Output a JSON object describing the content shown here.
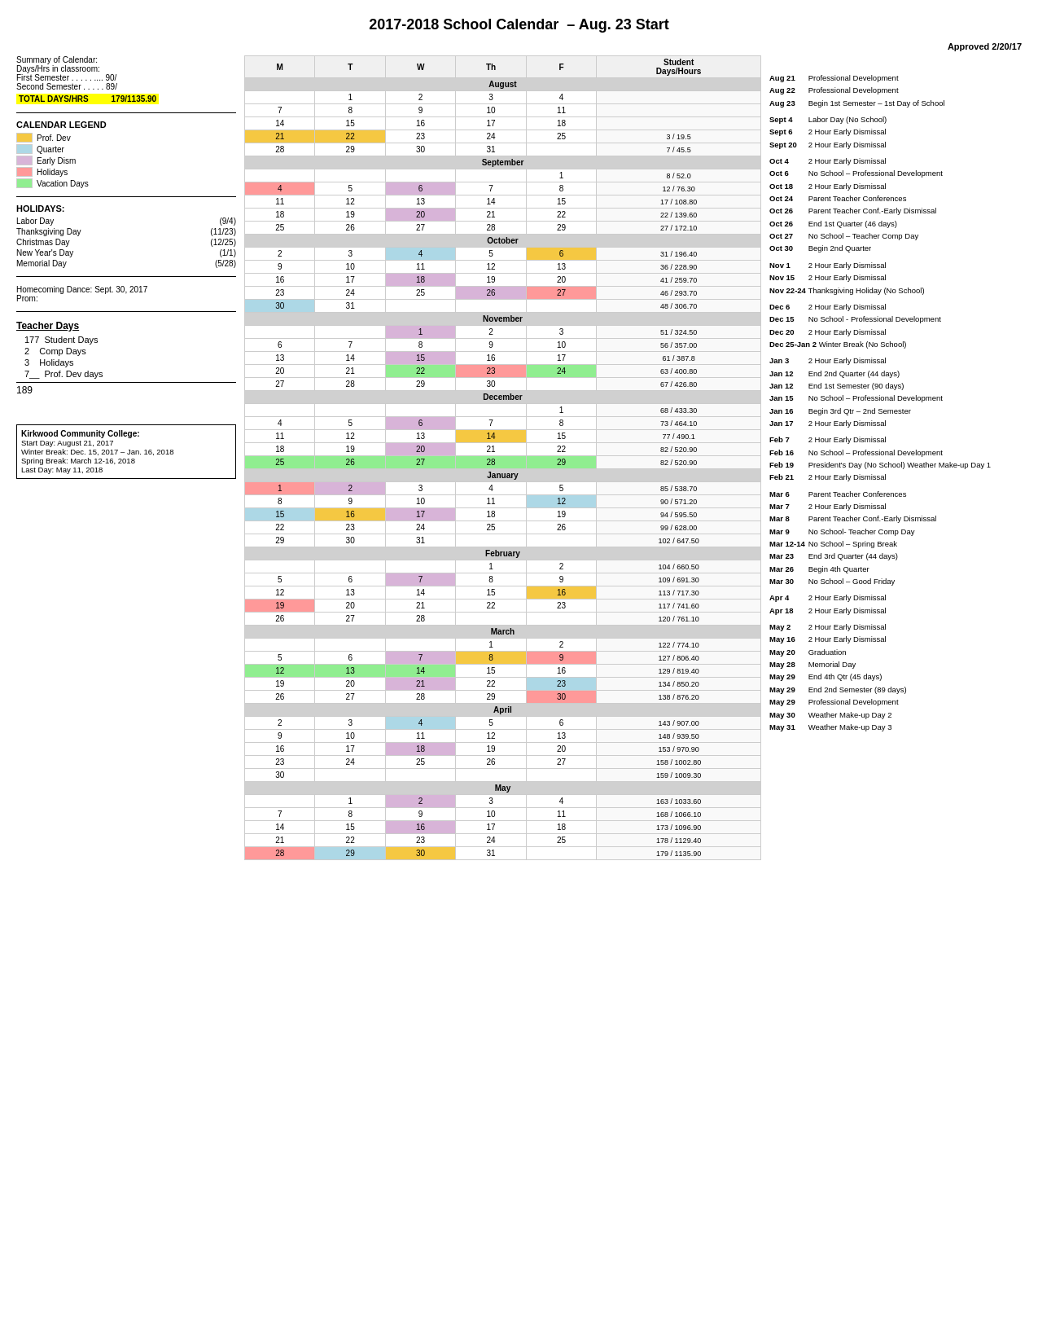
{
  "title": "2017-2018 School Calendar",
  "subtitle": "Aug. 23 Start",
  "approved": "Approved 2/20/17",
  "summary": {
    "label1": "Summary of Calendar:",
    "label2": "Days/Hrs in classroom:",
    "first_semester": "First Semester . . . . . .... 90/",
    "second_semester": "Second Semester . . . . . 89/",
    "total_label": "TOTAL DAYS/HRS",
    "total_value": "179/",
    "total_sub": "1135.90"
  },
  "legend": {
    "title": "CALENDAR LEGEND",
    "items": [
      {
        "label": "Prof. Dev",
        "color": "#f5c842"
      },
      {
        "label": "Quarter",
        "color": "#add8e6"
      },
      {
        "label": "Early Dism",
        "color": "#d8b4d8"
      },
      {
        "label": "Holidays",
        "color": "#ff9999"
      },
      {
        "label": "Vacation Days",
        "color": "#90ee90"
      }
    ]
  },
  "holidays": {
    "title": "HOLIDAYS:",
    "items": [
      {
        "name": "Labor Day",
        "date": "(9/4)"
      },
      {
        "name": "Thanksgiving Day",
        "date": "(11/23)"
      },
      {
        "name": "Christmas Day",
        "date": "(12/25)"
      },
      {
        "name": "New Year's Day",
        "date": "(1/1)"
      },
      {
        "name": "Memorial Day",
        "date": "(5/28)"
      }
    ]
  },
  "events": [
    "Homecoming Dance: Sept. 30, 2017",
    "Prom:"
  ],
  "teacher_days": {
    "title": "Teacher Days",
    "items": [
      {
        "number": "177",
        "label": "Student Days"
      },
      {
        "number": "2",
        "label": "Comp Days"
      },
      {
        "number": "3",
        "label": "Holidays"
      },
      {
        "number": "7__",
        "label": "Prof. Dev days"
      }
    ],
    "total": "189"
  },
  "kcc": {
    "title": "Kirkwood Community College:",
    "items": [
      "Start Day:  August 21, 2017",
      "Winter Break: Dec. 15, 2017 – Jan. 16, 2018",
      "Spring Break: March 12-16, 2018",
      "Last Day: May 11, 2018"
    ]
  },
  "col_headers": [
    "M",
    "T",
    "W",
    "Th",
    "F",
    "Student Days/Hours"
  ],
  "months": [
    {
      "name": "August",
      "weeks": [
        [
          null,
          1,
          2,
          3,
          4,
          null
        ],
        [
          7,
          8,
          9,
          10,
          11,
          null
        ],
        [
          14,
          15,
          16,
          17,
          18,
          null
        ],
        [
          "21Y",
          "22Y",
          "23O",
          24,
          "25",
          "3 / 19.5"
        ],
        [
          28,
          29,
          30,
          31,
          null,
          "7 / 45.5"
        ]
      ]
    },
    {
      "name": "September",
      "weeks": [
        [
          null,
          null,
          null,
          null,
          "1",
          "8 / 52.0"
        ],
        [
          "4H",
          5,
          "6E",
          7,
          "8",
          "12 / 76.30"
        ],
        [
          11,
          12,
          13,
          14,
          "15",
          "17 / 108.80"
        ],
        [
          18,
          19,
          "20E",
          21,
          "22",
          "22 / 139.60"
        ],
        [
          25,
          26,
          27,
          28,
          "29",
          "27 / 172.10"
        ]
      ]
    },
    {
      "name": "October",
      "weeks": [
        [
          2,
          3,
          "4Q",
          5,
          "6Y",
          "31 / 196.40"
        ],
        [
          9,
          10,
          11,
          12,
          "13",
          "36 / 228.90"
        ],
        [
          16,
          17,
          "18E",
          19,
          "20",
          "41 / 259.70"
        ],
        [
          23,
          24,
          25,
          "26E",
          "27H",
          "46 / 293.70"
        ],
        [
          "30Q",
          31,
          null,
          null,
          null,
          "48 / 306.70"
        ]
      ]
    },
    {
      "name": "November",
      "weeks": [
        [
          null,
          null,
          "1E",
          2,
          "3",
          "51 / 324.50"
        ],
        [
          6,
          7,
          8,
          9,
          "10",
          "56 / 357.00"
        ],
        [
          13,
          14,
          "15E",
          16,
          "17",
          "61 / 387.8"
        ],
        [
          20,
          21,
          "22V",
          "23H",
          "24V",
          "63 / 400.80"
        ],
        [
          27,
          28,
          29,
          30,
          null,
          "67 / 426.80"
        ]
      ]
    },
    {
      "name": "December",
      "weeks": [
        [
          null,
          null,
          null,
          null,
          "1",
          "68 / 433.30"
        ],
        [
          4,
          5,
          "6E",
          7,
          "8",
          "73 / 464.10"
        ],
        [
          11,
          12,
          13,
          "14Y",
          "15",
          "77 / 490.1"
        ],
        [
          18,
          19,
          "20E",
          21,
          "22",
          "82 / 520.90"
        ],
        [
          "25V",
          "26V",
          "27V",
          "28V",
          "29V",
          "82 / 520.90"
        ]
      ]
    },
    {
      "name": "January",
      "weeks": [
        [
          "1H",
          "2E",
          3,
          4,
          "5",
          "85 / 538.70"
        ],
        [
          8,
          9,
          10,
          "11",
          "12Q",
          "90 / 571.20"
        ],
        [
          "15Q",
          "16Y",
          "17E",
          18,
          "19",
          "94 / 595.50"
        ],
        [
          22,
          23,
          24,
          25,
          "26",
          "99 / 628.00"
        ],
        [
          29,
          30,
          31,
          null,
          null,
          "102 / 647.50"
        ]
      ]
    },
    {
      "name": "February",
      "weeks": [
        [
          null,
          null,
          null,
          1,
          "2",
          "104 / 660.50"
        ],
        [
          5,
          6,
          "7E",
          8,
          "9",
          "109 / 691.30"
        ],
        [
          12,
          13,
          14,
          15,
          "16Y",
          "113 / 717.30"
        ],
        [
          "19H",
          20,
          21,
          22,
          "23",
          "117 / 741.60"
        ],
        [
          26,
          27,
          28,
          null,
          null,
          "120 / 761.10"
        ]
      ]
    },
    {
      "name": "March",
      "weeks": [
        [
          null,
          null,
          null,
          1,
          "2",
          "122 / 774.10"
        ],
        [
          5,
          6,
          "7E",
          "8Y",
          "9H",
          "127 / 806.40"
        ],
        [
          "12V",
          "13V",
          "14V",
          15,
          "16",
          "129 / 819.40"
        ],
        [
          19,
          20,
          "21E",
          22,
          "23Q",
          "134 / 850.20"
        ],
        [
          26,
          27,
          28,
          29,
          "30H",
          "138 / 876.20"
        ]
      ]
    },
    {
      "name": "April",
      "weeks": [
        [
          2,
          3,
          "4Q",
          5,
          "6",
          "143 / 907.00"
        ],
        [
          9,
          10,
          11,
          12,
          "13",
          "148 / 939.50"
        ],
        [
          16,
          17,
          "18E",
          19,
          "20",
          "153 / 970.90"
        ],
        [
          23,
          24,
          25,
          26,
          "27",
          "158 / 1002.80"
        ],
        [
          30,
          null,
          null,
          null,
          null,
          "159 / 1009.30"
        ]
      ]
    },
    {
      "name": "May",
      "weeks": [
        [
          null,
          1,
          "2E",
          3,
          "4",
          "163 / 1033.60"
        ],
        [
          7,
          8,
          9,
          10,
          "11",
          "168 / 1066.10"
        ],
        [
          14,
          15,
          "16E",
          17,
          "18",
          "173 / 1096.90"
        ],
        [
          21,
          22,
          23,
          24,
          "25",
          "178 / 1129.40"
        ],
        [
          "28H",
          "29Q",
          "30Y",
          31,
          null,
          "179 / 1135.90"
        ]
      ]
    }
  ],
  "right_events": [
    {
      "date": "Aug 21",
      "text": "Professional Development"
    },
    {
      "date": "Aug 22",
      "text": "Professional Development"
    },
    {
      "date": "Aug 23",
      "text": "Begin 1st Semester – 1st Day of School"
    },
    {
      "spacer": true
    },
    {
      "date": "Sept 4",
      "text": "Labor Day (No School)"
    },
    {
      "date": "Sept 6",
      "text": "2 Hour Early Dismissal"
    },
    {
      "date": "Sept 20",
      "text": "2 Hour Early Dismissal"
    },
    {
      "spacer": true
    },
    {
      "date": "Oct 4",
      "text": "2 Hour Early Dismissal"
    },
    {
      "date": "Oct 6",
      "text": "No School – Professional Development"
    },
    {
      "date": "Oct 18",
      "text": "2 Hour Early Dismissal"
    },
    {
      "date": "Oct 24",
      "text": "Parent Teacher Conferences"
    },
    {
      "date": "Oct 26",
      "text": "Parent Teacher Conf.-Early Dismissal"
    },
    {
      "date": "Oct 26",
      "text": "End 1st Quarter (46 days)"
    },
    {
      "date": "Oct 27",
      "text": "No School – Teacher Comp Day"
    },
    {
      "date": "Oct 30",
      "text": "Begin 2nd Quarter"
    },
    {
      "spacer": true
    },
    {
      "date": "Nov 1",
      "text": "2 Hour Early Dismissal"
    },
    {
      "date": "Nov 15",
      "text": "2 Hour Early Dismissal"
    },
    {
      "date": "Nov 22-24",
      "text": "Thanksgiving Holiday (No School)"
    },
    {
      "spacer": true
    },
    {
      "date": "Dec 6",
      "text": "2 Hour Early Dismissal"
    },
    {
      "date": "Dec 15",
      "text": "No School - Professional Development"
    },
    {
      "date": "Dec 20",
      "text": "2 Hour Early Dismissal"
    },
    {
      "date": "Dec 25-Jan 2",
      "text": "Winter Break (No School)"
    },
    {
      "spacer": true
    },
    {
      "date": "Jan 3",
      "text": "2 Hour Early Dismissal"
    },
    {
      "date": "Jan 12",
      "text": "End 2nd Quarter (44 days)"
    },
    {
      "date": "Jan 12",
      "text": "End 1st Semester (90 days)"
    },
    {
      "date": "Jan 15",
      "text": "No School – Professional Development"
    },
    {
      "date": "Jan 16",
      "text": "Begin 3rd Qtr – 2nd Semester"
    },
    {
      "date": "Jan 17",
      "text": "2 Hour Early Dismissal"
    },
    {
      "spacer": true
    },
    {
      "date": "Feb 7",
      "text": "2 Hour Early Dismissal"
    },
    {
      "date": "Feb 16",
      "text": "No School – Professional Development"
    },
    {
      "date": "Feb 19",
      "text": "President's Day (No School) Weather Make-up Day 1"
    },
    {
      "date": "Feb 21",
      "text": "2 Hour Early Dismissal"
    },
    {
      "spacer": true
    },
    {
      "date": "Mar 6",
      "text": "Parent Teacher Conferences"
    },
    {
      "date": "Mar 7",
      "text": "2 Hour Early Dismissal"
    },
    {
      "date": "Mar 8",
      "text": "Parent Teacher Conf.-Early Dismissal"
    },
    {
      "date": "Mar 9",
      "text": "No School- Teacher Comp Day"
    },
    {
      "date": "Mar 12-14",
      "text": "No School – Spring Break"
    },
    {
      "date": "Mar 23",
      "text": "End 3rd Quarter (44 days)"
    },
    {
      "date": "Mar 26",
      "text": "Begin 4th Quarter"
    },
    {
      "date": "Mar 30",
      "text": "No School – Good Friday"
    },
    {
      "spacer": true
    },
    {
      "date": "Apr 4",
      "text": "2 Hour Early Dismissal"
    },
    {
      "date": "Apr 18",
      "text": "2 Hour Early Dismissal"
    },
    {
      "spacer": true
    },
    {
      "date": "May 2",
      "text": "2 Hour Early Dismissal"
    },
    {
      "date": "May 16",
      "text": "2 Hour Early Dismissal"
    },
    {
      "date": "May 20",
      "text": "Graduation"
    },
    {
      "date": "May 28",
      "text": "Memorial Day"
    },
    {
      "date": "May 29",
      "text": "End 4th Qtr (45 days)"
    },
    {
      "date": "May 29",
      "text": "End 2nd Semester (89 days)"
    },
    {
      "date": "May 29",
      "text": "Professional Development"
    },
    {
      "date": "May 30",
      "text": "Weather Make-up Day 2"
    },
    {
      "date": "May 31",
      "text": "Weather Make-up Day 3"
    }
  ]
}
